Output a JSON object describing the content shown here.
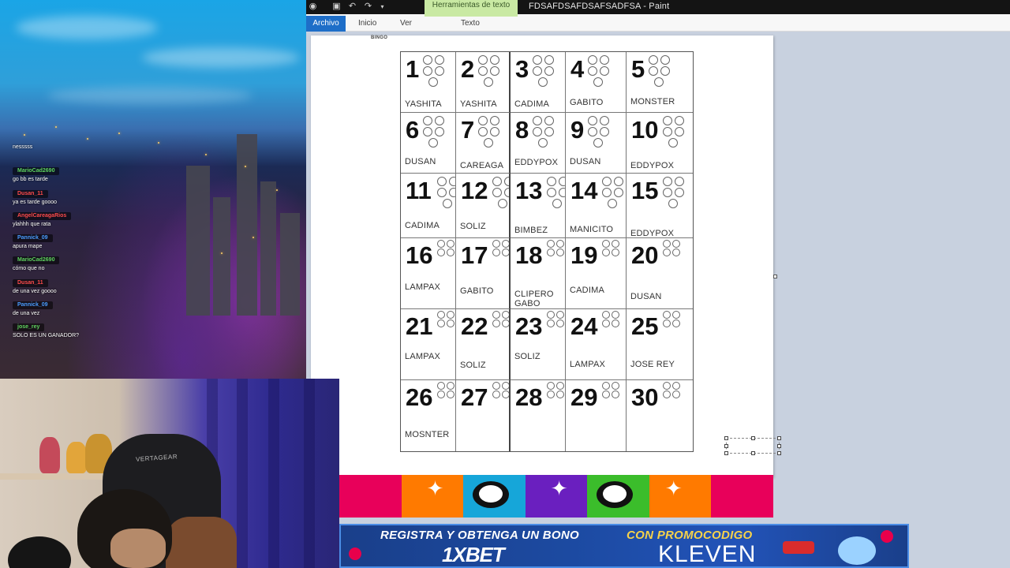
{
  "paint": {
    "context_tab": "Herramientas de texto",
    "window_title": "FDSAFDSAFDSAFSADFSA - Paint",
    "tabs": {
      "archivo": "Archivo",
      "inicio": "Inicio",
      "ver": "Ver",
      "texto": "Texto"
    },
    "quick_access": [
      "paint-app-icon",
      "save-icon",
      "undo-icon",
      "redo-icon",
      "customize-dropdown-icon"
    ]
  },
  "canvas": {
    "header_label": "BINGO",
    "cells": [
      {
        "n": "1",
        "name": "YASHITA"
      },
      {
        "n": "2",
        "name": "YASHITA"
      },
      {
        "n": "3",
        "name": "CADIMA"
      },
      {
        "n": "4",
        "name": "GABITO"
      },
      {
        "n": "5",
        "name": "MONSTER"
      },
      {
        "n": "6",
        "name": "DUSAN"
      },
      {
        "n": "7",
        "name": "CAREAGA"
      },
      {
        "n": "8",
        "name": "EDDYPOX"
      },
      {
        "n": "9",
        "name": "DUSAN"
      },
      {
        "n": "10",
        "name": "EDDYPOX"
      },
      {
        "n": "11",
        "name": "CADIMA"
      },
      {
        "n": "12",
        "name": "SOLIZ"
      },
      {
        "n": "13",
        "name": "BIMBEZ"
      },
      {
        "n": "14",
        "name": "MANICITO"
      },
      {
        "n": "15",
        "name": "EDDYPOX"
      },
      {
        "n": "16",
        "name": "LAMPAX"
      },
      {
        "n": "17",
        "name": "GABITO"
      },
      {
        "n": "18",
        "name": "CLIPERO GABO"
      },
      {
        "n": "19",
        "name": "CADIMA"
      },
      {
        "n": "20",
        "name": "DUSAN"
      },
      {
        "n": "21",
        "name": "LAMPAX"
      },
      {
        "n": "22",
        "name": "SOLIZ"
      },
      {
        "n": "23",
        "name": "SOLIZ"
      },
      {
        "n": "24",
        "name": "LAMPAX"
      },
      {
        "n": "25",
        "name": "JOSE REY"
      },
      {
        "n": "26",
        "name": "MOSNTER"
      },
      {
        "n": "27",
        "name": ""
      },
      {
        "n": "28",
        "name": ""
      },
      {
        "n": "29",
        "name": ""
      },
      {
        "n": "30",
        "name": ""
      }
    ]
  },
  "chat": {
    "messages": [
      {
        "user": "",
        "text": "nesssss",
        "color": "#ffffff"
      },
      {
        "user": "MarioCad2690",
        "text": "go bb es tarde",
        "color": "#5fd35f"
      },
      {
        "user": "Dusan_11",
        "text": "ya es tarde goooo",
        "color": "#ff4b4b"
      },
      {
        "user": "AngelCareagaRios",
        "text": "ylahhh que rata",
        "color": "#ff4b4b"
      },
      {
        "user": "Pannick_09",
        "text": "apura mape",
        "color": "#4a9dff"
      },
      {
        "user": "MarioCad2690",
        "text": "cómo que no",
        "color": "#5fd35f"
      },
      {
        "user": "Dusan_11",
        "text": "de una vez goooo",
        "color": "#ff4b4b"
      },
      {
        "user": "Pannick_09",
        "text": "de una vez",
        "color": "#4a9dff"
      },
      {
        "user": "jose_rey",
        "text": "SOLO ES UN GANADOR?",
        "color": "#5fd35f"
      }
    ]
  },
  "ad": {
    "line1": "REGISTRA Y OBTENGA UN BONO",
    "brand_prefix": "1X",
    "brand_suffix": "BET",
    "promo_label": "CON PROMOCODIGO",
    "promo_code": "KLEVEN"
  },
  "webcam": {
    "chair_brand": "VERTAGEAR"
  },
  "colors": {
    "archivo_tab": "#1e6ec8",
    "context_tab": "#c9e9a3",
    "workspace": "#c8d1df",
    "banner_stripes": [
      "#e8005a",
      "#ff7a00",
      "#16a6d9",
      "#6a1fbf",
      "#3bbd2b",
      "#ff7a00",
      "#e8005a"
    ]
  }
}
